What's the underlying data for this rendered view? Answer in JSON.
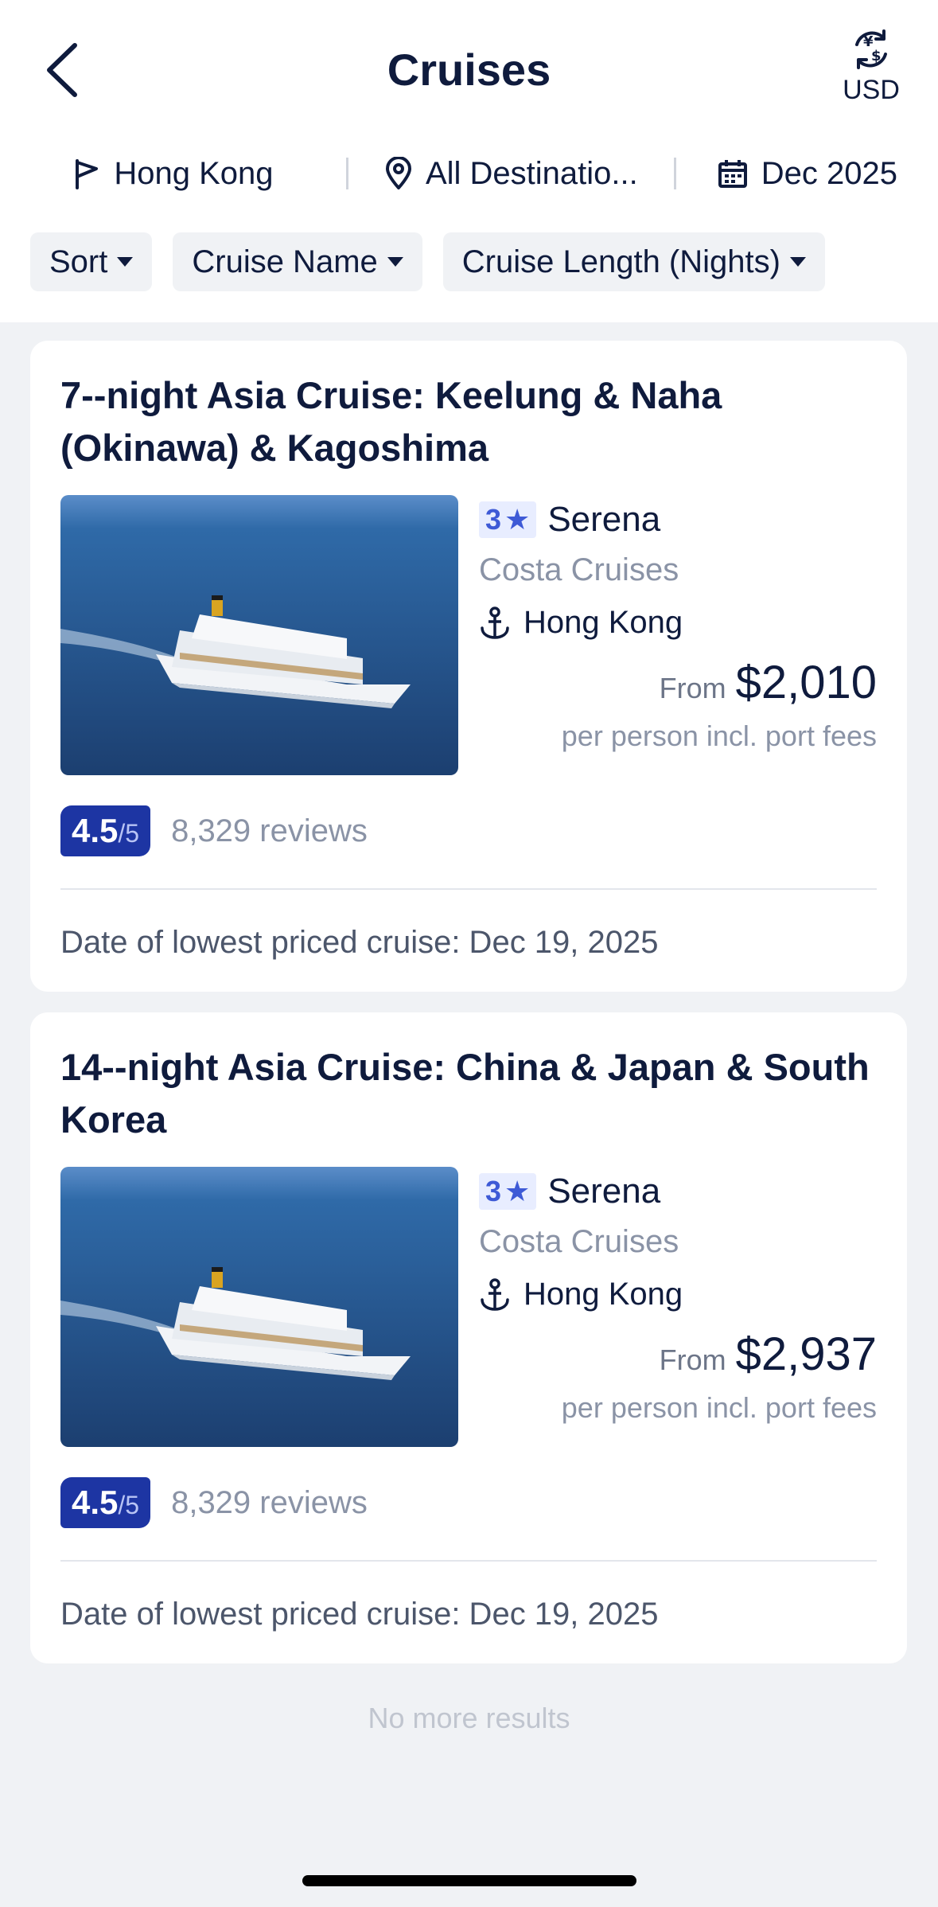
{
  "header": {
    "title": "Cruises",
    "currency": "USD"
  },
  "filters": {
    "departure": "Hong Kong",
    "destination": "All Destinatio...",
    "date": "Dec 2025"
  },
  "chips": [
    {
      "label": "Sort"
    },
    {
      "label": "Cruise Name"
    },
    {
      "label": "Cruise Length (Nights)"
    }
  ],
  "cruises": [
    {
      "title": "7--night Asia Cruise: Keelung & Naha (Okinawa) & Kagoshima",
      "stars": "3",
      "ship": "Serena",
      "line": "Costa Cruises",
      "port": "Hong Kong",
      "from_label": "From",
      "price": "$2,010",
      "price_note": "per person incl. port fees",
      "rating": "4.5",
      "rating_max": "/5",
      "reviews": "8,329 reviews",
      "lowest_date": "Date of lowest priced cruise: Dec 19, 2025"
    },
    {
      "title": "14--night Asia Cruise: China & Japan & South Korea",
      "stars": "3",
      "ship": "Serena",
      "line": "Costa Cruises",
      "port": "Hong Kong",
      "from_label": "From",
      "price": "$2,937",
      "price_note": "per person incl. port fees",
      "rating": "4.5",
      "rating_max": "/5",
      "reviews": "8,329 reviews",
      "lowest_date": "Date of lowest priced cruise: Dec 19, 2025"
    }
  ],
  "footer": {
    "no_more": "No more results"
  },
  "colors": {
    "primary_text": "#0f1b3d",
    "rating_badge": "#1d35a3",
    "star_badge": "#3e5ad6",
    "secondary_text": "#8a93a6",
    "background": "#f0f2f5"
  }
}
